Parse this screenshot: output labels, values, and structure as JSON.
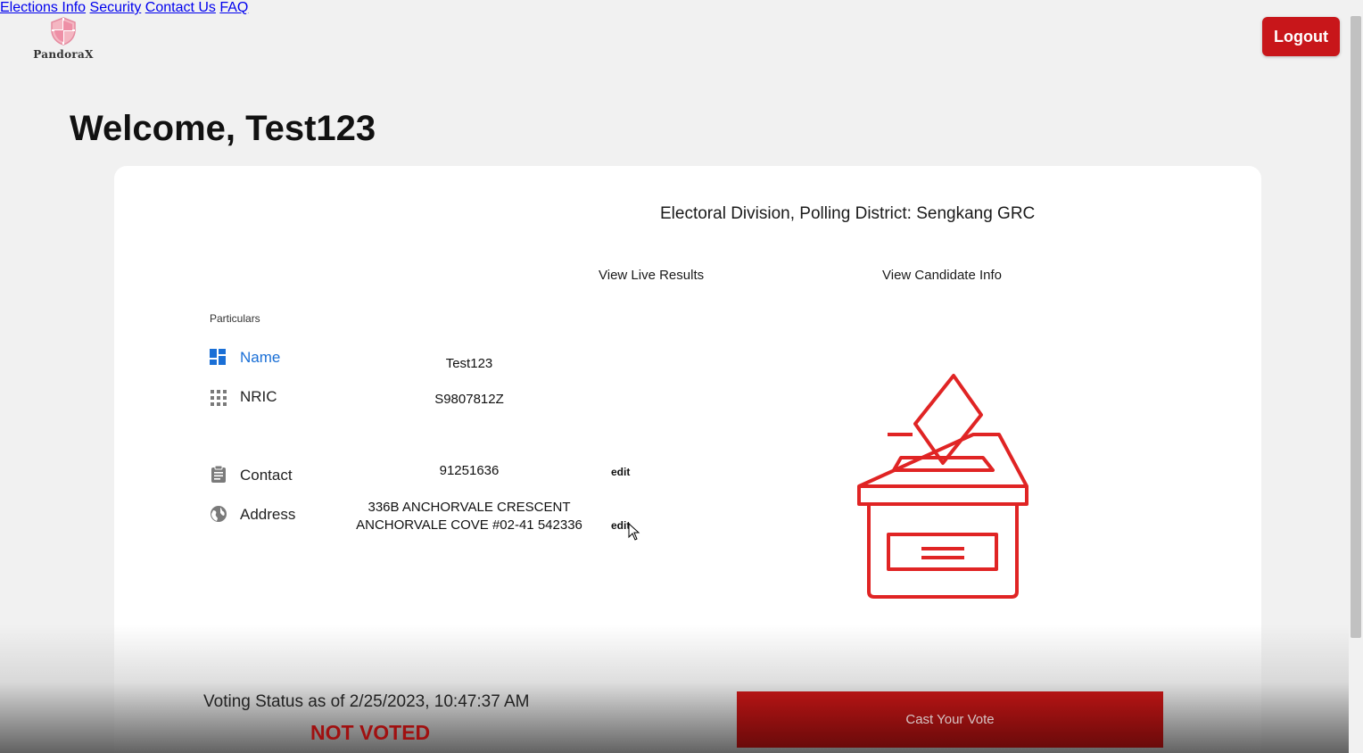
{
  "brand": {
    "name": "PandoraX",
    "accent": "#c8161a"
  },
  "nav": {
    "items": [
      "Elections Info",
      "Security",
      "Contact Us",
      "FAQ"
    ],
    "logout_label": "Logout"
  },
  "welcome": "Welcome, Test123",
  "card": {
    "division": "Electoral Division, Polling District: Sengkang GRC",
    "view_live_results": "View Live Results",
    "view_candidate_info": "View Candidate Info",
    "particulars_heading": "Particulars",
    "rows": {
      "name": {
        "label": "Name",
        "value": "Test123",
        "icon": "dashboard-icon"
      },
      "nric": {
        "label": "NRIC",
        "value": "S9807812Z",
        "icon": "grid-icon"
      },
      "contact": {
        "label": "Contact",
        "value": "91251636",
        "icon": "clipboard-icon",
        "edit": "edit"
      },
      "address": {
        "label": "Address",
        "value_line1": "336B ANCHORVALE CRESCENT",
        "value_line2": "ANCHORVALE COVE #02-41 542336",
        "icon": "globe-icon",
        "edit": "edit"
      }
    }
  },
  "status": {
    "line": "Voting Status as of 2/25/2023, 10:47:37 AM",
    "value": "NOT VOTED"
  },
  "cast_vote_label": "Cast Your Vote"
}
